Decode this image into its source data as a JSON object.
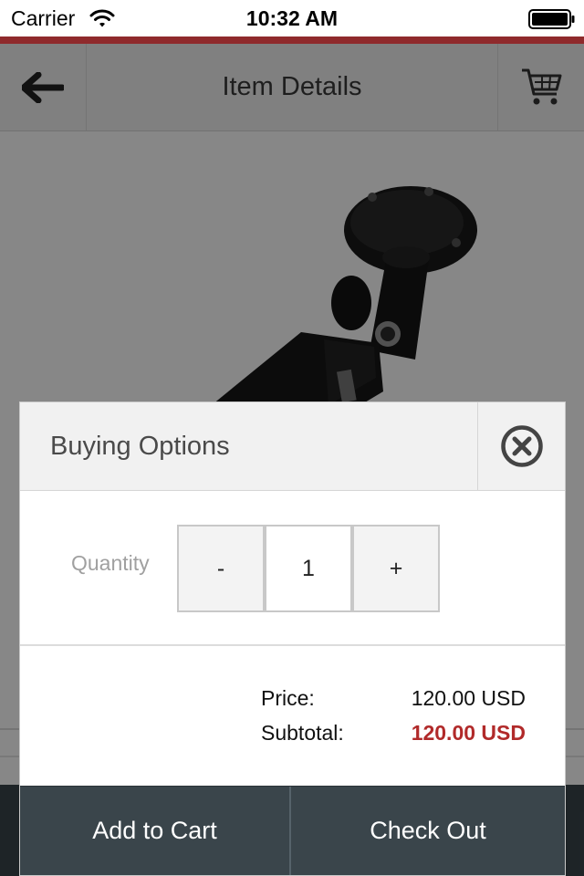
{
  "status_bar": {
    "carrier": "Carrier",
    "time": "10:32 AM"
  },
  "nav": {
    "title": "Item Details",
    "back_icon": "arrow-left-icon",
    "cart_icon": "cart-icon"
  },
  "modal": {
    "title": "Buying Options",
    "close_icon": "close-circle-icon",
    "quantity_label": "Quantity",
    "decrement_label": "-",
    "quantity_value": "1",
    "increment_label": "+",
    "price_label": "Price:",
    "price_value": "120.00 USD",
    "subtotal_label": "Subtotal:",
    "subtotal_value": "120.00 USD",
    "add_to_cart_label": "Add to Cart",
    "checkout_label": "Check Out"
  },
  "colors": {
    "accent": "#8f2a2c",
    "subtotal": "#b12a2a",
    "action_bar": "#3a454b"
  }
}
